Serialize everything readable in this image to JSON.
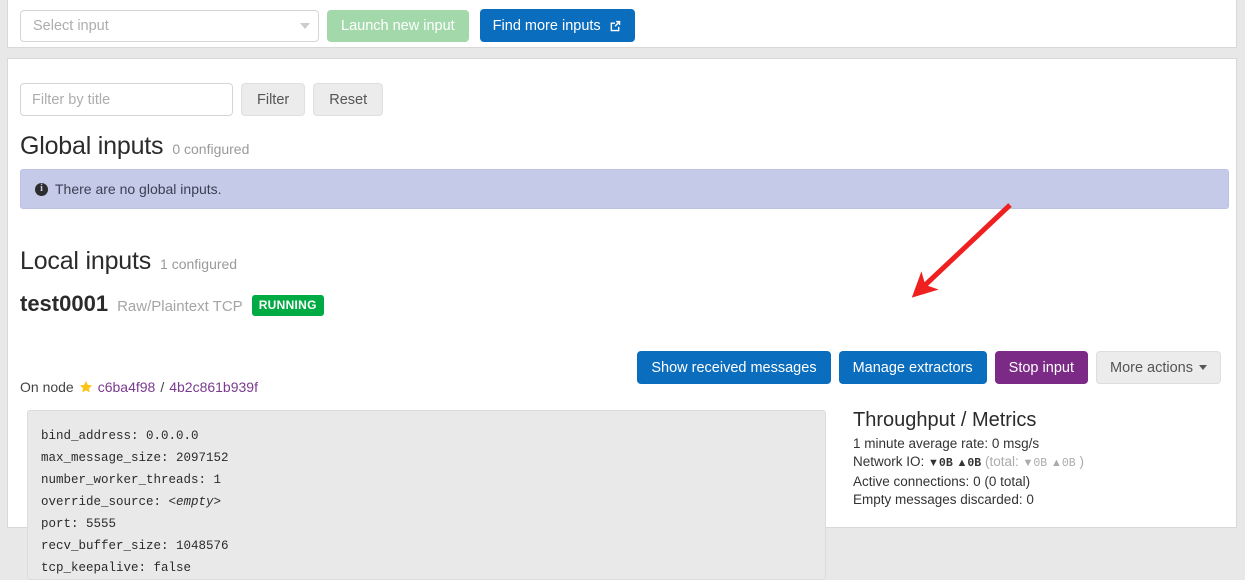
{
  "toolbar": {
    "select_placeholder": "Select input",
    "dropdown_icon": "chevron-down-icon",
    "launch_label": "Launch new input",
    "find_label": "Find more inputs",
    "find_icon": "external-link-icon"
  },
  "filter": {
    "placeholder": "Filter by title",
    "value": "",
    "filter_label": "Filter",
    "reset_label": "Reset"
  },
  "global_section": {
    "title": "Global inputs",
    "count_label": "0 configured",
    "alert_icon": "info-icon",
    "alert_text": "There are no global inputs."
  },
  "local_section": {
    "title": "Local inputs",
    "count_label": "1 configured"
  },
  "input": {
    "name": "test0001",
    "type": "Raw/Plaintext TCP",
    "status": "RUNNING",
    "status_color": "#00ab44",
    "node_prefix": "On node",
    "node_icon": "star-icon",
    "node_short": "c6ba4f98",
    "node_separator": "/",
    "node_full": "4b2c861b939f"
  },
  "actions": {
    "show_messages": "Show received messages",
    "manage_extractors": "Manage extractors",
    "stop_input": "Stop input",
    "more_actions": "More actions",
    "more_icon": "caret-down-icon",
    "blue": "#0b6dbd",
    "purple": "#7b2a85"
  },
  "config": {
    "lines": [
      "bind_address: 0.0.0.0",
      "max_message_size: 2097152",
      "number_worker_threads: 1",
      "port: 5555",
      "recv_buffer_size: 1048576",
      "tcp_keepalive: false"
    ],
    "override_source_key": "override_source:",
    "override_source_value": "<empty>"
  },
  "metrics": {
    "title": "Throughput / Metrics",
    "rate_line": "1 minute average rate: 0 msg/s",
    "network_label": "Network IO:",
    "in_arrow": "▼",
    "in_value": "0B",
    "out_arrow": "▲",
    "out_value": "0B",
    "total_open": "(total:",
    "total_in_arrow": "▼",
    "total_in_value": "0B",
    "total_out_arrow": "▲",
    "total_out_value": "0B",
    "total_close": ")",
    "connections_line": "Active connections: 0 (0 total)",
    "discarded_line": "Empty messages discarded: 0"
  },
  "annotation": {
    "arrow_color": "#ef2020"
  }
}
